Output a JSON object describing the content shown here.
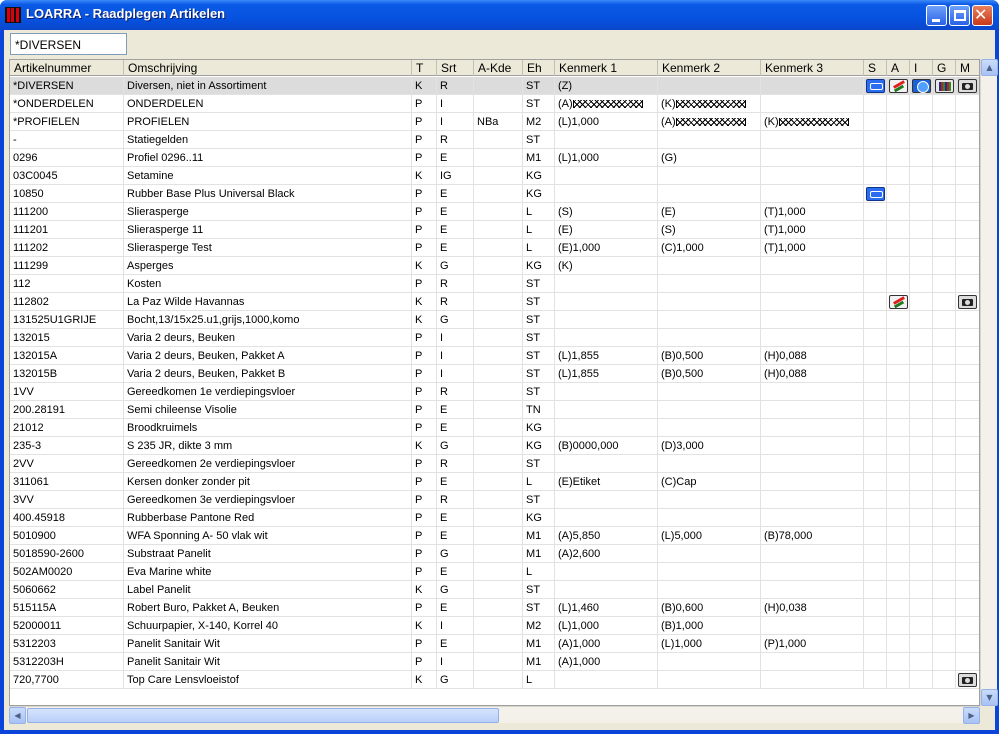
{
  "window": {
    "title": "LOARRA - Raadplegen Artikelen"
  },
  "search": {
    "value": "*DIVERSEN"
  },
  "columns": [
    "Artikelnummer",
    "Omschrijving",
    "T",
    "Srt",
    "A-Kde",
    "Eh",
    "Kenmerk 1",
    "Kenmerk 2",
    "Kenmerk 3",
    "S",
    "A",
    "I",
    "G",
    "M"
  ],
  "rows": [
    {
      "nr": "*DIVERSEN",
      "oms": "Diversen, niet in Assortiment",
      "t": "K",
      "srt": "R",
      "akde": "",
      "eh": "ST",
      "k1": "(Z)",
      "k2": "",
      "k3": "",
      "icons": [
        "car-icon",
        "paint-icon",
        "globe-icon",
        "books-icon",
        "camera-icon"
      ]
    },
    {
      "nr": "*ONDERDELEN",
      "oms": "ONDERDELEN",
      "t": "P",
      "srt": "I",
      "akde": "",
      "eh": "ST",
      "k1": "(A)XXXXXXXXXX",
      "k2": "(K)XXXXXXXXXX",
      "k3": "",
      "icons": []
    },
    {
      "nr": "*PROFIELEN",
      "oms": "PROFIELEN",
      "t": "P",
      "srt": "I",
      "akde": "NBa",
      "eh": "M2",
      "k1": "(L)1,000",
      "k2": "(A)XXXXXXXXXX",
      "k3": "(K)XXXXXXXXXX",
      "icons": []
    },
    {
      "nr": "-",
      "oms": "Statiegelden",
      "t": "P",
      "srt": "R",
      "akde": "",
      "eh": "ST",
      "k1": "",
      "k2": "",
      "k3": "",
      "icons": []
    },
    {
      "nr": "0296",
      "oms": "Profiel 0296..11",
      "t": "P",
      "srt": "E",
      "akde": "",
      "eh": "M1",
      "k1": "(L)1,000",
      "k2": "(G)",
      "k3": "",
      "icons": []
    },
    {
      "nr": "03C0045",
      "oms": "Setamine",
      "t": "K",
      "srt": "IG",
      "akde": "",
      "eh": "KG",
      "k1": "",
      "k2": "",
      "k3": "",
      "icons": []
    },
    {
      "nr": "10850",
      "oms": "Rubber Base Plus Universal Black",
      "t": "P",
      "srt": "E",
      "akde": "",
      "eh": "KG",
      "k1": "",
      "k2": "",
      "k3": "",
      "icons": [
        "car-icon"
      ]
    },
    {
      "nr": "111200",
      "oms": "Slierasperge",
      "t": "P",
      "srt": "E",
      "akde": "",
      "eh": "L",
      "k1": "(S)",
      "k2": "(E)",
      "k3": "(T)1,000",
      "icons": []
    },
    {
      "nr": "111201",
      "oms": "Slierasperge 11",
      "t": "P",
      "srt": "E",
      "akde": "",
      "eh": "L",
      "k1": "(E)",
      "k2": "(S)",
      "k3": "(T)1,000",
      "icons": []
    },
    {
      "nr": "111202",
      "oms": "Slierasperge Test",
      "t": "P",
      "srt": "E",
      "akde": "",
      "eh": "L",
      "k1": "(E)1,000",
      "k2": "(C)1,000",
      "k3": "(T)1,000",
      "icons": []
    },
    {
      "nr": "111299",
      "oms": "Asperges",
      "t": "K",
      "srt": "G",
      "akde": "",
      "eh": "KG",
      "k1": "(K)",
      "k2": "",
      "k3": "",
      "icons": []
    },
    {
      "nr": "112",
      "oms": "Kosten",
      "t": "P",
      "srt": "R",
      "akde": "",
      "eh": "ST",
      "k1": "",
      "k2": "",
      "k3": "",
      "icons": []
    },
    {
      "nr": "112802",
      "oms": "La Paz Wilde Havannas",
      "t": "K",
      "srt": "R",
      "akde": "",
      "eh": "ST",
      "k1": "",
      "k2": "",
      "k3": "",
      "icons": [
        "paint-icon",
        "camera-icon"
      ]
    },
    {
      "nr": "131525U1GRIJE",
      "oms": "Bocht,13/15x25.u1,grijs,1000,komo",
      "t": "K",
      "srt": "G",
      "akde": "",
      "eh": "ST",
      "k1": "",
      "k2": "",
      "k3": "",
      "icons": []
    },
    {
      "nr": "132015",
      "oms": "Varia 2 deurs, Beuken",
      "t": "P",
      "srt": "I",
      "akde": "",
      "eh": "ST",
      "k1": "",
      "k2": "",
      "k3": "",
      "icons": []
    },
    {
      "nr": "132015A",
      "oms": "Varia 2 deurs, Beuken, Pakket A",
      "t": "P",
      "srt": "I",
      "akde": "",
      "eh": "ST",
      "k1": "(L)1,855",
      "k2": "(B)0,500",
      "k3": "(H)0,088",
      "icons": []
    },
    {
      "nr": "132015B",
      "oms": "Varia 2 deurs, Beuken, Pakket B",
      "t": "P",
      "srt": "I",
      "akde": "",
      "eh": "ST",
      "k1": "(L)1,855",
      "k2": "(B)0,500",
      "k3": "(H)0,088",
      "icons": []
    },
    {
      "nr": "1VV",
      "oms": "Gereedkomen 1e verdiepingsvloer",
      "t": "P",
      "srt": "R",
      "akde": "",
      "eh": "ST",
      "k1": "",
      "k2": "",
      "k3": "",
      "icons": []
    },
    {
      "nr": "200.28191",
      "oms": "Semi chileense Visolie",
      "t": "P",
      "srt": "E",
      "akde": "",
      "eh": "TN",
      "k1": "",
      "k2": "",
      "k3": "",
      "icons": []
    },
    {
      "nr": "21012",
      "oms": "Broodkruimels",
      "t": "P",
      "srt": "E",
      "akde": "",
      "eh": "KG",
      "k1": "",
      "k2": "",
      "k3": "",
      "icons": []
    },
    {
      "nr": "235-3",
      "oms": "S 235 JR, dikte 3 mm",
      "t": "K",
      "srt": "G",
      "akde": "",
      "eh": "KG",
      "k1": "(B)0000,000",
      "k2": "(D)3,000",
      "k3": "",
      "icons": []
    },
    {
      "nr": "2VV",
      "oms": "Gereedkomen 2e verdiepingsvloer",
      "t": "P",
      "srt": "R",
      "akde": "",
      "eh": "ST",
      "k1": "",
      "k2": "",
      "k3": "",
      "icons": []
    },
    {
      "nr": "311061",
      "oms": "Kersen donker zonder pit",
      "t": "P",
      "srt": "E",
      "akde": "",
      "eh": "L",
      "k1": "(E)Etiket",
      "k2": "(C)Cap",
      "k3": "",
      "icons": []
    },
    {
      "nr": "3VV",
      "oms": "Gereedkomen 3e verdiepingsvloer",
      "t": "P",
      "srt": "R",
      "akde": "",
      "eh": "ST",
      "k1": "",
      "k2": "",
      "k3": "",
      "icons": []
    },
    {
      "nr": "400.45918",
      "oms": "Rubberbase Pantone Red",
      "t": "P",
      "srt": "E",
      "akde": "",
      "eh": "KG",
      "k1": "",
      "k2": "",
      "k3": "",
      "icons": []
    },
    {
      "nr": "5010900",
      "oms": "WFA Sponning A- 50 vlak wit",
      "t": "P",
      "srt": "E",
      "akde": "",
      "eh": "M1",
      "k1": "(A)5,850",
      "k2": "(L)5,000",
      "k3": "(B)78,000",
      "icons": []
    },
    {
      "nr": "5018590-2600",
      "oms": "Substraat Panelit",
      "t": "P",
      "srt": "G",
      "akde": "",
      "eh": "M1",
      "k1": "(A)2,600",
      "k2": "",
      "k3": "",
      "icons": []
    },
    {
      "nr": "502AM0020",
      "oms": "Eva Marine white",
      "t": "P",
      "srt": "E",
      "akde": "",
      "eh": "L",
      "k1": "",
      "k2": "",
      "k3": "",
      "icons": []
    },
    {
      "nr": "5060662",
      "oms": "Label Panelit",
      "t": "K",
      "srt": "G",
      "akde": "",
      "eh": "ST",
      "k1": "",
      "k2": "",
      "k3": "",
      "icons": []
    },
    {
      "nr": "515115A",
      "oms": "Robert Buro, Pakket A, Beuken",
      "t": "P",
      "srt": "E",
      "akde": "",
      "eh": "ST",
      "k1": "(L)1,460",
      "k2": "(B)0,600",
      "k3": "(H)0,038",
      "icons": []
    },
    {
      "nr": "52000011",
      "oms": "Schuurpapier, X-140, Korrel 40",
      "t": "K",
      "srt": "I",
      "akde": "",
      "eh": "M2",
      "k1": "(L)1,000",
      "k2": "(B)1,000",
      "k3": "",
      "icons": []
    },
    {
      "nr": "5312203",
      "oms": "Panelit Sanitair Wit",
      "t": "P",
      "srt": "E",
      "akde": "",
      "eh": "M1",
      "k1": "(A)1,000",
      "k2": "(L)1,000",
      "k3": "(P)1,000",
      "icons": []
    },
    {
      "nr": "5312203H",
      "oms": "Panelit Sanitair Wit",
      "t": "P",
      "srt": "I",
      "akde": "",
      "eh": "M1",
      "k1": "(A)1,000",
      "k2": "",
      "k3": "",
      "icons": []
    },
    {
      "nr": "720,7700",
      "oms": "Top Care Lensvloeistof",
      "t": "K",
      "srt": "G",
      "akde": "",
      "eh": "L",
      "k1": "",
      "k2": "",
      "k3": "",
      "icons": [
        "camera-icon"
      ]
    }
  ],
  "colors": {
    "titlebar": "#0653e0",
    "selected_row": "#dcdcdc"
  }
}
